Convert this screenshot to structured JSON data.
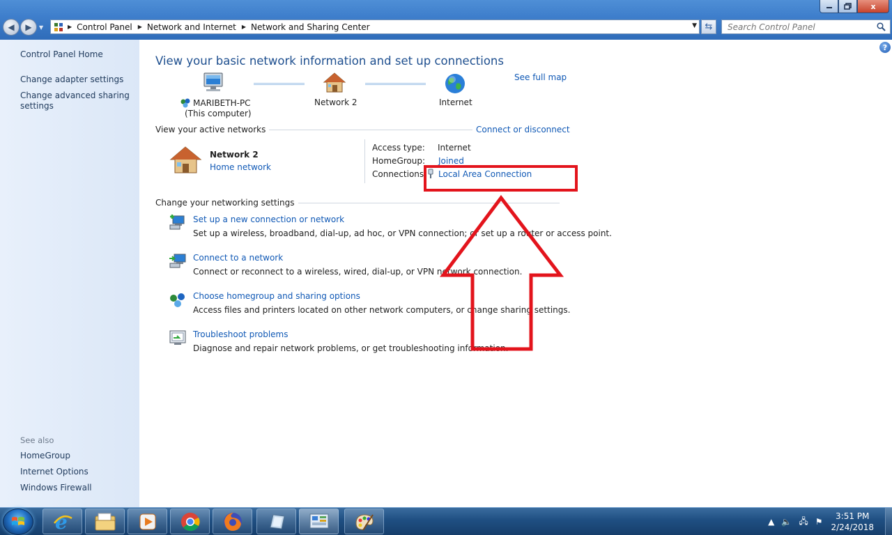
{
  "window": {
    "minimize_icon": "minimize-icon",
    "maximize_icon": "restore-icon",
    "close_label": "x"
  },
  "address": {
    "crumbs": [
      "Control Panel",
      "Network and Internet",
      "Network and Sharing Center"
    ]
  },
  "search": {
    "placeholder": "Search Control Panel"
  },
  "sidebar": {
    "home": "Control Panel Home",
    "items": [
      "Change adapter settings",
      "Change advanced sharing",
      "settings"
    ],
    "see_also_title": "See also",
    "see_also": [
      "HomeGroup",
      "Internet Options",
      "Windows Firewall"
    ]
  },
  "main": {
    "title": "View your basic network information and set up connections",
    "see_full_map": "See full map",
    "map": {
      "computer_name": "MARIBETH-PC",
      "computer_note": "(This computer)",
      "network": "Network  2",
      "internet": "Internet"
    },
    "active_title": "View your active networks",
    "connect_disconnect": "Connect or disconnect",
    "active_network": {
      "name": "Network  2",
      "type": "Home network",
      "access_label": "Access type:",
      "access_value": "Internet",
      "homegroup_label": "HomeGroup:",
      "homegroup_value": "Joined",
      "connections_label": "Connections:",
      "connections_value": "Local Area Connection"
    },
    "settings_title": "Change your networking settings",
    "tasks": [
      {
        "title": "Set up a new connection or network",
        "desc": "Set up a wireless, broadband, dial-up, ad hoc, or VPN connection; or set up a router or access point."
      },
      {
        "title": "Connect to a network",
        "desc": "Connect or reconnect to a wireless, wired, dial-up, or VPN network connection."
      },
      {
        "title": "Choose homegroup and sharing options",
        "desc": "Access files and printers located on other network computers, or change sharing settings."
      },
      {
        "title": "Troubleshoot problems",
        "desc": "Diagnose and repair network problems, or get troubleshooting information."
      }
    ]
  },
  "taskbar": {
    "time": "3:51 PM",
    "date": "2/24/2018"
  },
  "colors": {
    "annotation": "#e3141c",
    "link": "#0f58b5",
    "title": "#1e4f8f"
  }
}
